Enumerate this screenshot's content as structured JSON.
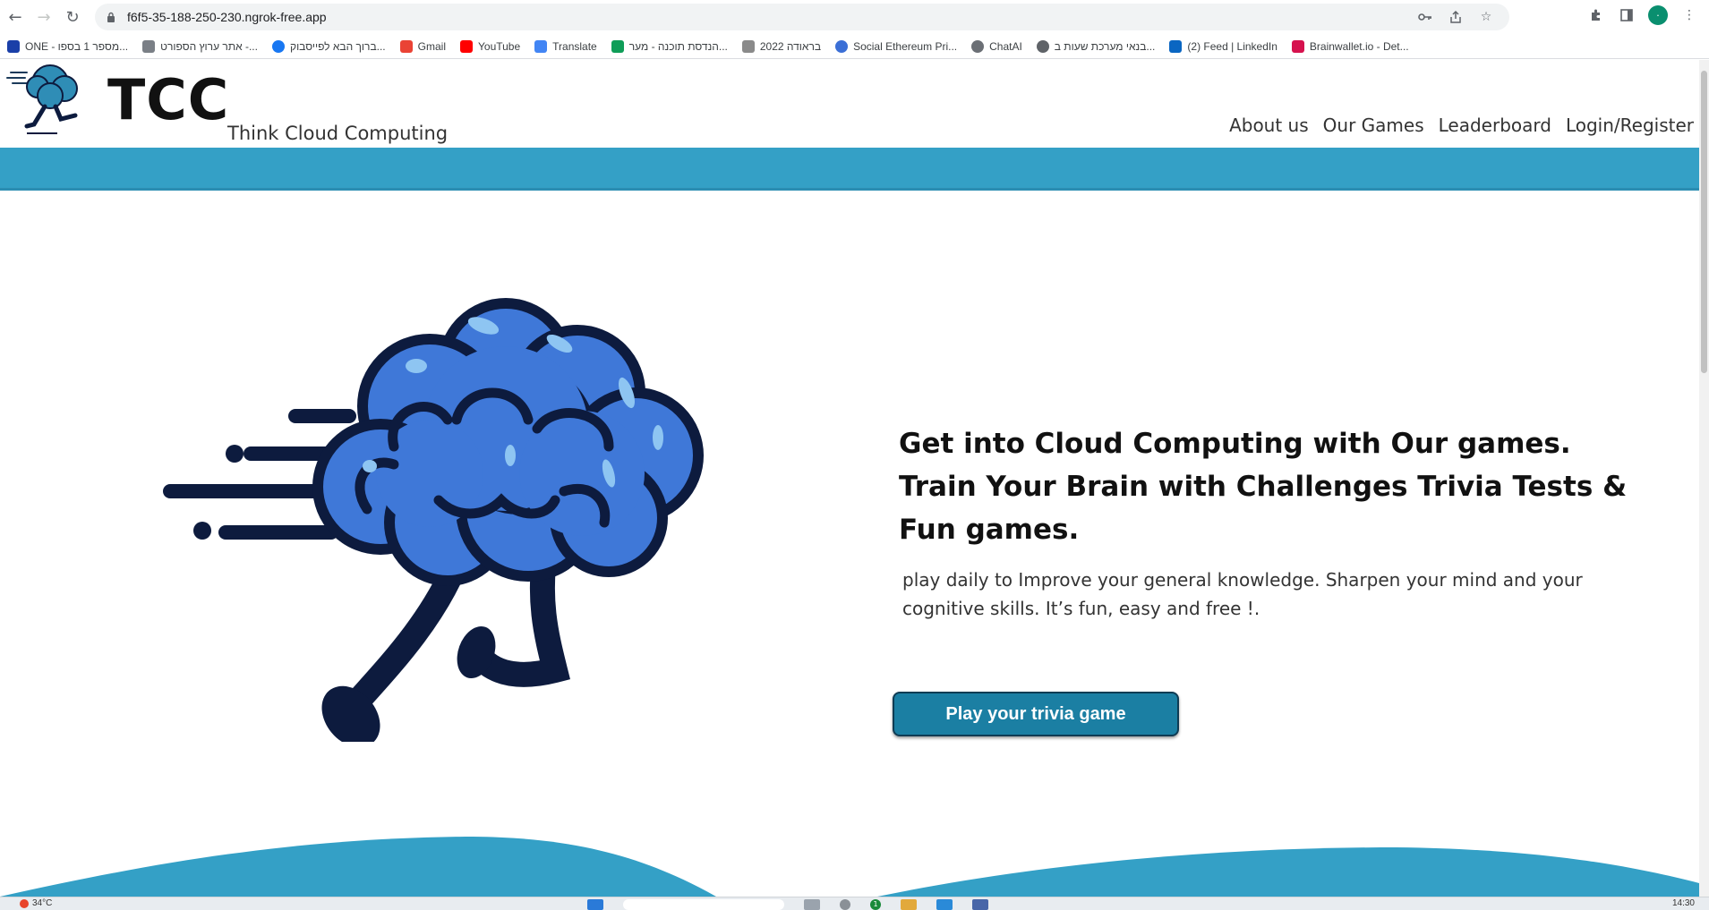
{
  "browser": {
    "url": "f6f5-35-188-250-230.ngrok-free.app",
    "profile_initial": "·",
    "bookmarks": [
      {
        "label": "ONE - מספר 1 בספו...",
        "icon": "one-icon",
        "color": "#1a3fa8"
      },
      {
        "label": "אתר ערוץ הספורט -...",
        "icon": "sport5-icon",
        "color": "#7a7f86"
      },
      {
        "label": "ברוך הבא לפייסבוק...",
        "icon": "facebook-icon",
        "color": "#1877f2"
      },
      {
        "label": "Gmail",
        "icon": "gmail-icon",
        "color": "#ea4335"
      },
      {
        "label": "YouTube",
        "icon": "youtube-icon",
        "color": "#ff0000"
      },
      {
        "label": "Translate",
        "icon": "translate-icon",
        "color": "#4285f4"
      },
      {
        "label": "הנדסת תוכנה - מער...",
        "icon": "sheets-icon",
        "color": "#0f9d58"
      },
      {
        "label": "בראודה 2022",
        "icon": "braude-icon",
        "color": "#8a8a8a"
      },
      {
        "label": "Social Ethereum Pri...",
        "icon": "ethereum-icon",
        "color": "#3b6fd6"
      },
      {
        "label": "ChatAI",
        "icon": "chatai-icon",
        "color": "#6b6f75"
      },
      {
        "label": "בנאי מערכת שעות ב...",
        "icon": "globe-icon",
        "color": "#5f6368"
      },
      {
        "label": "(2) Feed | LinkedIn",
        "icon": "linkedin-icon",
        "color": "#0a66c2"
      },
      {
        "label": "Brainwallet.io - Det...",
        "icon": "brainwallet-icon",
        "color": "#d6124e"
      }
    ]
  },
  "site": {
    "logo_title": "TCC",
    "logo_subtitle": "Think Cloud Computing",
    "nav": [
      "About us",
      "Our Games",
      "Leaderboard",
      "Login/Register"
    ],
    "hero_title": "Get into Cloud Computing with Our games. Train Your Brain with Challenges Trivia Tests & Fun games.",
    "hero_description": "play daily to Improve your general knowledge. Sharpen your mind and your cognitive skills. It’s fun, easy and free !.",
    "cta_label": "Play your trivia game",
    "colors": {
      "band": "#34a0c6",
      "button": "#1b7fa3",
      "brain": "#3f78d8",
      "outline": "#0d1b3e"
    }
  },
  "taskbar": {
    "temperature": "34°C",
    "time": "14:30",
    "notification_count": "1"
  }
}
